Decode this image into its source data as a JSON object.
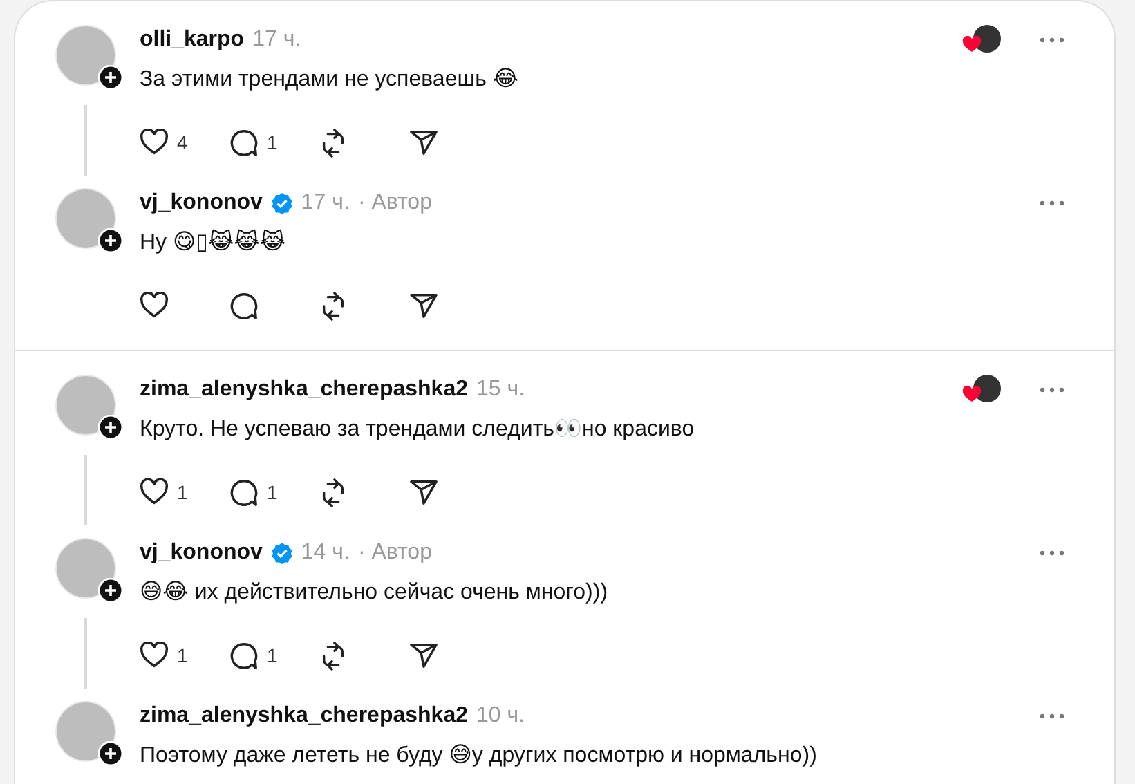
{
  "threads": [
    {
      "posts": [
        {
          "username": "olli_karpo",
          "verified": false,
          "time": "17 ч.",
          "text": "За этими трендами не успеваешь 😂",
          "liked_by_author": true,
          "likes": "4",
          "replies": "1"
        },
        {
          "username": "vj_kononov",
          "verified": true,
          "time": "17 ч.",
          "author_label": "· Автор",
          "text": "Ну 😋▯😹😹😹",
          "liked_by_author": false
        }
      ]
    },
    {
      "posts": [
        {
          "username": "zima_alenyshka_cherepashka2",
          "verified": false,
          "time": "15 ч.",
          "text": "Круто. Не успеваю за трендами следить👀но красиво",
          "liked_by_author": true,
          "likes": "1",
          "replies": "1"
        },
        {
          "username": "vj_kononov",
          "verified": true,
          "time": "14 ч.",
          "author_label": "· Автор",
          "text": "😅😂 их действительно сейчас очень много)))",
          "liked_by_author": false,
          "likes": "1",
          "replies": "1"
        },
        {
          "username": "zima_alenyshka_cherepashka2",
          "verified": false,
          "time": "10 ч.",
          "text": "Поэтому даже лететь не буду 😅у других посмотрю и нормально))",
          "liked_by_author": false
        }
      ]
    }
  ]
}
